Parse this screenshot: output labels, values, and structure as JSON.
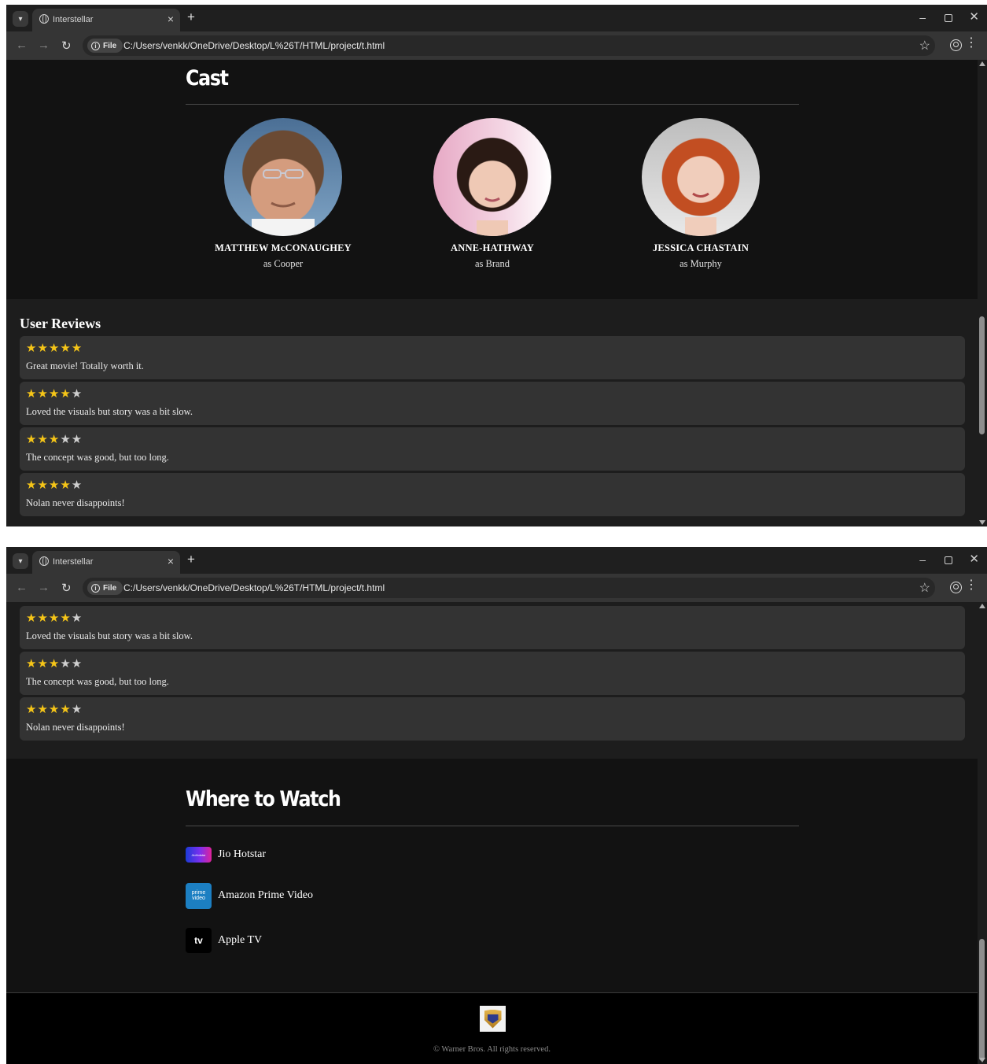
{
  "browser": {
    "tab_title": "Interstellar",
    "tab_close": "×",
    "new_tab": "+",
    "site_chip": "File",
    "url": "C:/Users/venkk/OneDrive/Desktop/L%26T/HTML/project/t.html"
  },
  "cast": {
    "title": "Cast",
    "members": [
      {
        "name": "MATTHEW McCONAUGHEY",
        "role": "as Cooper"
      },
      {
        "name": "ANNE-HATHWAY",
        "role": "as Brand"
      },
      {
        "name": "JESSICA CHASTAIN",
        "role": "as Murphy"
      }
    ]
  },
  "reviews": {
    "title": "User Reviews",
    "items": [
      {
        "stars_on": "★★★★★",
        "stars_off": "",
        "text": "Great movie! Totally worth it."
      },
      {
        "stars_on": "★★★★",
        "stars_off": "★",
        "text": "Loved the visuals but story was a bit slow."
      },
      {
        "stars_on": "★★★",
        "stars_off": "★★",
        "text": "The concept was good, but too long."
      },
      {
        "stars_on": "★★★★",
        "stars_off": "★",
        "text": "Nolan never disappoints!"
      }
    ]
  },
  "watch": {
    "title": "Where to Watch",
    "platforms": [
      {
        "name": "Jio Hotstar",
        "logo_text": "JioHotstar"
      },
      {
        "name": "Amazon Prime Video",
        "logo_line1": "prime",
        "logo_line2": "video"
      },
      {
        "name": "Apple TV",
        "logo_text": "tv"
      }
    ]
  },
  "footer": {
    "copyright": "© Warner Bros. All rights reserved."
  }
}
